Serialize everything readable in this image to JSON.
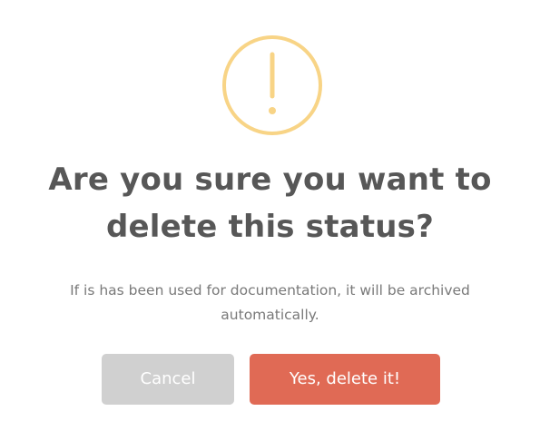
{
  "dialog": {
    "icon": "warning-exclamation-icon",
    "title_line1": "Are you sure you want to",
    "title_line2": "delete this status?",
    "message_line1": "If is has been used for documentation, it will be archived",
    "message_line2": "automatically.",
    "cancel_label": "Cancel",
    "confirm_label": "Yes, delete it!"
  },
  "colors": {
    "icon_ring": "#f8d486",
    "title": "#575757",
    "message": "#797979",
    "cancel_bg": "#d0d0d0",
    "confirm_bg": "#e06a55"
  }
}
